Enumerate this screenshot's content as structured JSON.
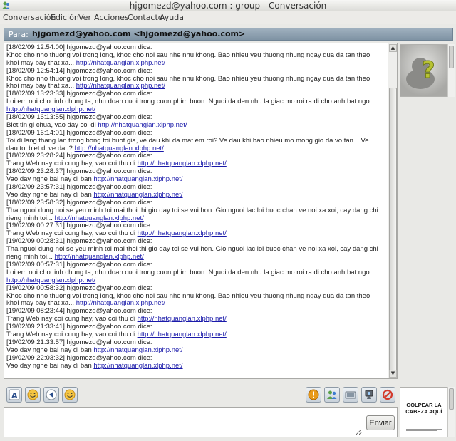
{
  "window": {
    "title": "hjgomezd@yahoo.com : group - Conversación"
  },
  "menu": [
    "Conversación",
    "Edición",
    "Ver",
    "Acciones",
    "Contacto",
    "Ayuda"
  ],
  "to_bar": {
    "label": "Para:",
    "value": "hjgomezd@yahoo.com <hjgomezd@yahoo.com>"
  },
  "chat": {
    "lines": [
      [
        {
          "t": "[18/02/09 12:54:00] hjgomezd@yahoo.com dice:"
        }
      ],
      [
        {
          "t": "Khoc cho nho thuong voi trong long, khoc cho noi sau nhe nhu khong. Bao nhieu yeu thuong nhung ngay qua da tan theo"
        }
      ],
      [
        {
          "t": "khoi may bay that xa...  "
        },
        {
          "t": "http://nhatquanglan.xlphp.net/",
          "link": true
        }
      ],
      [
        {
          "t": "[18/02/09 12:54:14] hjgomezd@yahoo.com dice:"
        }
      ],
      [
        {
          "t": "Khoc cho nho thuong voi trong long, khoc cho noi sau nhe nhu khong. Bao nhieu yeu thuong nhung ngay qua da tan theo"
        }
      ],
      [
        {
          "t": "khoi may bay that xa...  "
        },
        {
          "t": "http://nhatquanglan.xlphp.net/",
          "link": true
        }
      ],
      [
        {
          "t": "[18/02/09 13:23:33] hjgomezd@yahoo.com dice:"
        }
      ],
      [
        {
          "t": "Loi em noi cho tinh chung ta, nhu doan cuoi trong cuon phim buon. Nguoi da den nhu la giac mo roi ra di cho anh bat ngo..."
        }
      ],
      [
        {
          "t": "http://nhatquanglan.xlphp.net/",
          "link": true
        }
      ],
      [
        {
          "t": "[18/02/09 16:13:55] hjgomezd@yahoo.com dice:"
        }
      ],
      [
        {
          "t": "Biet tin gi chua, vao day coi di "
        },
        {
          "t": "http://nhatquanglan.xlphp.net/",
          "link": true
        }
      ],
      [
        {
          "t": "[18/02/09 16:14:01] hjgomezd@yahoo.com dice:"
        }
      ],
      [
        {
          "t": "Toi di lang thang lan trong bong toi buot gia, ve dau khi da mat em roi? Ve dau khi bao nhieu mo mong gio da vo tan... Ve"
        }
      ],
      [
        {
          "t": "dau toi biet di ve dau?  "
        },
        {
          "t": "http://nhatquanglan.xlphp.net/",
          "link": true
        }
      ],
      [
        {
          "t": "[18/02/09 23:28:24] hjgomezd@yahoo.com dice:"
        }
      ],
      [
        {
          "t": "Trang Web nay coi cung hay, vao coi thu di "
        },
        {
          "t": "http://nhatquanglan.xlphp.net/",
          "link": true
        }
      ],
      [
        {
          "t": "[18/02/09 23:28:37] hjgomezd@yahoo.com dice:"
        }
      ],
      [
        {
          "t": "Vao day nghe bai nay di ban "
        },
        {
          "t": "http://nhatquanglan.xlphp.net/",
          "link": true
        }
      ],
      [
        {
          "t": "[18/02/09 23:57:31] hjgomezd@yahoo.com dice:"
        }
      ],
      [
        {
          "t": "Vao day nghe bai nay di ban "
        },
        {
          "t": "http://nhatquanglan.xlphp.net/",
          "link": true
        }
      ],
      [
        {
          "t": "[18/02/09 23:58:32] hjgomezd@yahoo.com dice:"
        }
      ],
      [
        {
          "t": "Tha nguoi dung noi se yeu minh toi mai thoi thi gio day toi se vui hon. Gio nguoi lac loi buoc chan ve noi xa xoi, cay dang chi"
        }
      ],
      [
        {
          "t": "rieng minh toi...  "
        },
        {
          "t": "http://nhatquanglan.xlphp.net/",
          "link": true
        }
      ],
      [
        {
          "t": "[19/02/09 00:27:31] hjgomezd@yahoo.com dice:"
        }
      ],
      [
        {
          "t": "Trang Web nay coi cung hay, vao coi thu di "
        },
        {
          "t": "http://nhatquanglan.xlphp.net/",
          "link": true
        }
      ],
      [
        {
          "t": "[19/02/09 00:28:31] hjgomezd@yahoo.com dice:"
        }
      ],
      [
        {
          "t": "Tha nguoi dung noi se yeu minh toi mai thoi thi gio day toi se vui hon. Gio nguoi lac loi buoc chan ve noi xa xoi, cay dang chi"
        }
      ],
      [
        {
          "t": "rieng minh toi...  "
        },
        {
          "t": "http://nhatquanglan.xlphp.net/",
          "link": true
        }
      ],
      [
        {
          "t": "[19/02/09 00:57:31] hjgomezd@yahoo.com dice:"
        }
      ],
      [
        {
          "t": "Loi em noi cho tinh chung ta, nhu doan cuoi trong cuon phim buon. Nguoi da den nhu la giac mo roi ra di cho anh bat ngo..."
        }
      ],
      [
        {
          "t": "http://nhatquanglan.xlphp.net/",
          "link": true
        }
      ],
      [
        {
          "t": "[19/02/09 00:58:32] hjgomezd@yahoo.com dice:"
        }
      ],
      [
        {
          "t": "Khoc cho nho thuong voi trong long, khoc cho noi sau nhe nhu khong. Bao nhieu yeu thuong nhung ngay qua da tan theo"
        }
      ],
      [
        {
          "t": "khoi may bay that xa...  "
        },
        {
          "t": "http://nhatquanglan.xlphp.net/",
          "link": true
        }
      ],
      [
        {
          "t": "[19/02/09 08:23:44] hjgomezd@yahoo.com dice:"
        }
      ],
      [
        {
          "t": "Trang Web nay coi cung hay, vao coi thu di "
        },
        {
          "t": "http://nhatquanglan.xlphp.net/",
          "link": true
        }
      ],
      [
        {
          "t": "[19/02/09 21:33:41] hjgomezd@yahoo.com dice:"
        }
      ],
      [
        {
          "t": "Trang Web nay coi cung hay, vao coi thu di "
        },
        {
          "t": "http://nhatquanglan.xlphp.net/",
          "link": true
        }
      ],
      [
        {
          "t": "[19/02/09 21:33:57] hjgomezd@yahoo.com dice:"
        }
      ],
      [
        {
          "t": "Vao day nghe bai nay di ban "
        },
        {
          "t": "http://nhatquanglan.xlphp.net/",
          "link": true
        }
      ],
      [
        {
          "t": "[19/02/09 22:03:32] hjgomezd@yahoo.com dice:"
        }
      ],
      [
        {
          "t": "Vao day nghe bai nay di ban "
        },
        {
          "t": "http://nhatquanglan.xlphp.net/",
          "link": true
        }
      ]
    ]
  },
  "toolbar": {
    "left": [
      "font-icon",
      "smiley-icon",
      "nudge-icon",
      "wink-icon"
    ],
    "right": [
      "warning-icon",
      "invite-contact-icon",
      "send-file-icon",
      "webcam-icon",
      "block-icon"
    ]
  },
  "input": {
    "value": "",
    "send_label": "Enviar"
  },
  "ad": {
    "text": "GOLPEAR LA CABEZA AQUÍ"
  },
  "colors": {
    "to_bar": "#8ea1b2",
    "link": "#1a1aaa",
    "block": "#d33a2c",
    "warning": "#e89a1a"
  }
}
